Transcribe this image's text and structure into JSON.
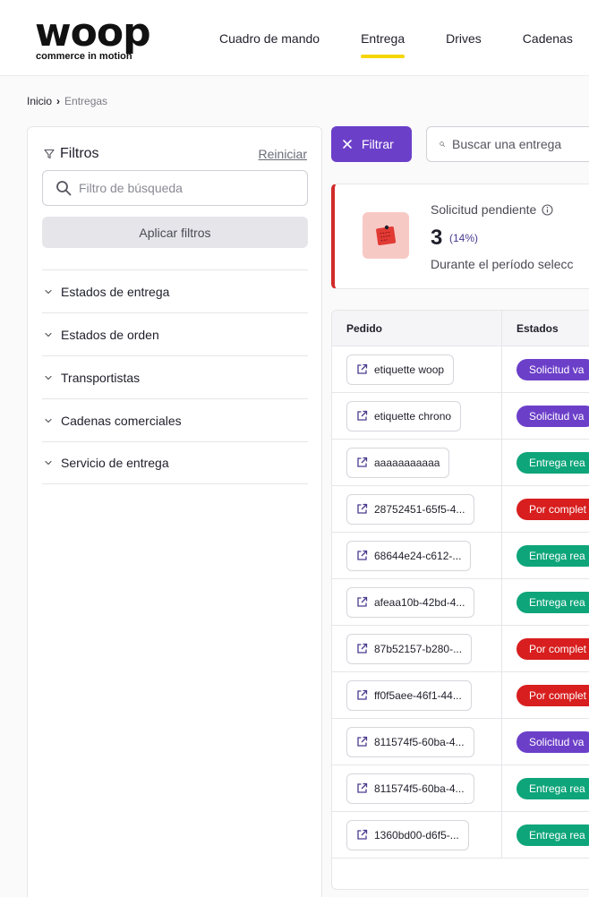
{
  "brand": {
    "wordmark": "woop",
    "tagline": "commerce in motion"
  },
  "nav": [
    {
      "label": "Cuadro de mando",
      "active": false
    },
    {
      "label": "Entrega",
      "active": true
    },
    {
      "label": "Drives",
      "active": false
    },
    {
      "label": "Cadenas",
      "active": false
    }
  ],
  "breadcrumb": {
    "home": "Inicio",
    "current": "Entregas"
  },
  "filters": {
    "title": "Filtros",
    "reset": "Reiniciar",
    "search_placeholder": "Filtro de búsqueda",
    "apply": "Aplicar filtros",
    "sections": [
      "Estados de entrega",
      "Estados de orden",
      "Transportistas",
      "Cadenas comerciales",
      "Servicio de entrega"
    ]
  },
  "toolbar": {
    "filter_label": "Filtrar",
    "search_placeholder": "Buscar una entrega"
  },
  "kpi": {
    "label": "Solicitud pendiente",
    "value": "3",
    "percent": "(14%)",
    "subtitle": "Durante el período selecc"
  },
  "table": {
    "headers": [
      "Pedido",
      "Estados"
    ],
    "rows": [
      {
        "order": "etiquette woop",
        "status": "Solicitud va",
        "tone": "purple"
      },
      {
        "order": "etiquette chrono",
        "status": "Solicitud va",
        "tone": "purple"
      },
      {
        "order": "aaaaaaaaaaa",
        "status": "Entrega rea",
        "tone": "green"
      },
      {
        "order": "28752451-65f5-4...",
        "status": "Por complet",
        "tone": "red"
      },
      {
        "order": "68644e24-c612-...",
        "status": "Entrega rea",
        "tone": "green"
      },
      {
        "order": "afeaa10b-42bd-4...",
        "status": "Entrega rea",
        "tone": "green"
      },
      {
        "order": "87b52157-b280-...",
        "status": "Por complet",
        "tone": "red"
      },
      {
        "order": "ff0f5aee-46f1-44...",
        "status": "Por complet",
        "tone": "red"
      },
      {
        "order": "811574f5-60ba-4...",
        "status": "Solicitud va",
        "tone": "purple"
      },
      {
        "order": "811574f5-60ba-4...",
        "status": "Entrega rea",
        "tone": "green"
      },
      {
        "order": "1360bd00-d6f5-...",
        "status": "Entrega rea",
        "tone": "green"
      }
    ]
  },
  "colors": {
    "accent": "#6c3fc9",
    "nav_underline": "#f6d600",
    "alert": "#d22b2b",
    "success": "#0ea57a",
    "danger": "#d81e1e"
  },
  "icons": [
    "search-icon",
    "funnel-icon",
    "chevron-down-icon",
    "close-icon",
    "info-icon",
    "external-link-icon",
    "pending-note-icon"
  ]
}
